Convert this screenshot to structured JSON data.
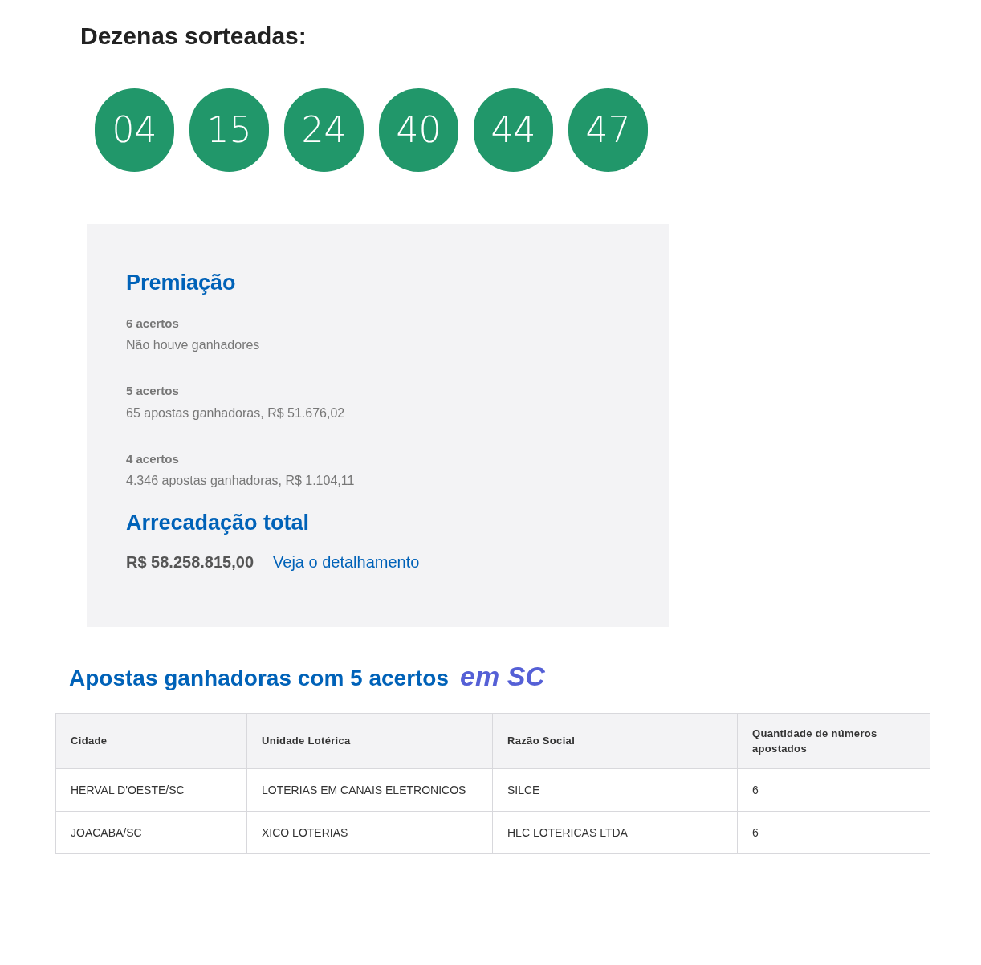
{
  "heading": "Dezenas sorteadas:",
  "numbers": [
    "04",
    "15",
    "24",
    "40",
    "44",
    "47"
  ],
  "prizes": {
    "title": "Premiação",
    "tiers": [
      {
        "label": "6 acertos",
        "result": "Não houve ganhadores"
      },
      {
        "label": "5 acertos",
        "result": "65 apostas ganhadoras, R$ 51.676,02"
      },
      {
        "label": "4 acertos",
        "result": "4.346 apostas ganhadoras, R$ 1.104,11"
      }
    ],
    "total_title": "Arrecadação total",
    "total_value": "R$ 58.258.815,00",
    "details_link": "Veja o detalhamento"
  },
  "winners": {
    "title": "Apostas ganhadoras com 5 acertos",
    "title_suffix": "em SC",
    "columns": [
      "Cidade",
      "Unidade Lotérica",
      "Razão Social",
      "Quantidade de números apostados"
    ],
    "rows": [
      [
        "HERVAL D'OESTE/SC",
        "LOTERIAS EM CANAIS ELETRONICOS",
        "SILCE",
        "6"
      ],
      [
        "JOACABA/SC",
        "XICO LOTERIAS",
        "HLC LOTERICAS LTDA",
        "6"
      ]
    ]
  }
}
